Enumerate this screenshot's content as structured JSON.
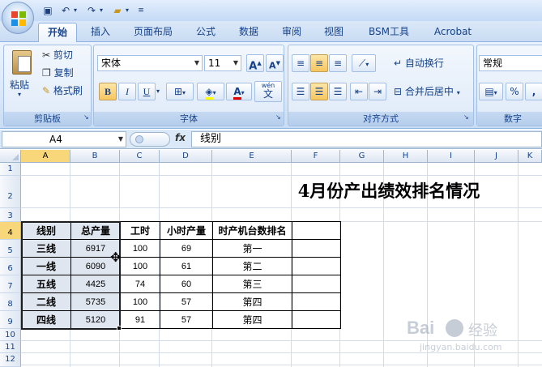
{
  "tabs": [
    "开始",
    "插入",
    "页面布局",
    "公式",
    "数据",
    "审阅",
    "视图",
    "BSM工具",
    "Acrobat"
  ],
  "active_tab": "开始",
  "clipboard": {
    "paste": "粘贴",
    "cut": "剪切",
    "copy": "复制",
    "format_painter": "格式刷",
    "group_label": "剪贴板"
  },
  "font": {
    "name": "宋体",
    "size": "11",
    "bold": "B",
    "italic": "I",
    "underline": "U",
    "group_label": "字体",
    "grow": "A",
    "shrink": "A",
    "font_color": "A",
    "phonetic_top": "wén",
    "phonetic_bottom": "文"
  },
  "alignment": {
    "wrap": "自动换行",
    "merge": "合并后居中",
    "group_label": "对齐方式"
  },
  "number": {
    "format": "常规",
    "percent": "%",
    "comma": ",",
    "group_label": "数字"
  },
  "formula_bar": {
    "name_box": "A4",
    "fx": "fx",
    "content": "线别"
  },
  "columns": [
    "A",
    "B",
    "C",
    "D",
    "E",
    "F",
    "G",
    "H",
    "I",
    "J",
    "K"
  ],
  "rows": [
    "1",
    "2",
    "3",
    "4",
    "5",
    "6",
    "7",
    "8",
    "9",
    "10",
    "11",
    "12"
  ],
  "sheet": {
    "title": "4月份产出绩效排名情况",
    "headers": [
      "线别",
      "总产量",
      "工时",
      "小时产量",
      "时产机台数排名"
    ],
    "data": [
      [
        "三线",
        "6917",
        "100",
        "69",
        "第一"
      ],
      [
        "一线",
        "6090",
        "100",
        "61",
        "第二"
      ],
      [
        "五线",
        "4425",
        "74",
        "60",
        "第三"
      ],
      [
        "二线",
        "5735",
        "100",
        "57",
        "第四"
      ],
      [
        "四线",
        "5120",
        "91",
        "57",
        "第四"
      ]
    ]
  },
  "watermark": {
    "brand": "Bai",
    "suffix": "经验",
    "url": "jingyan.baidu.com"
  },
  "colors": {
    "ribbon": "#dbe8f8",
    "accent": "#15428b",
    "selected_header": "#f8d77a"
  }
}
